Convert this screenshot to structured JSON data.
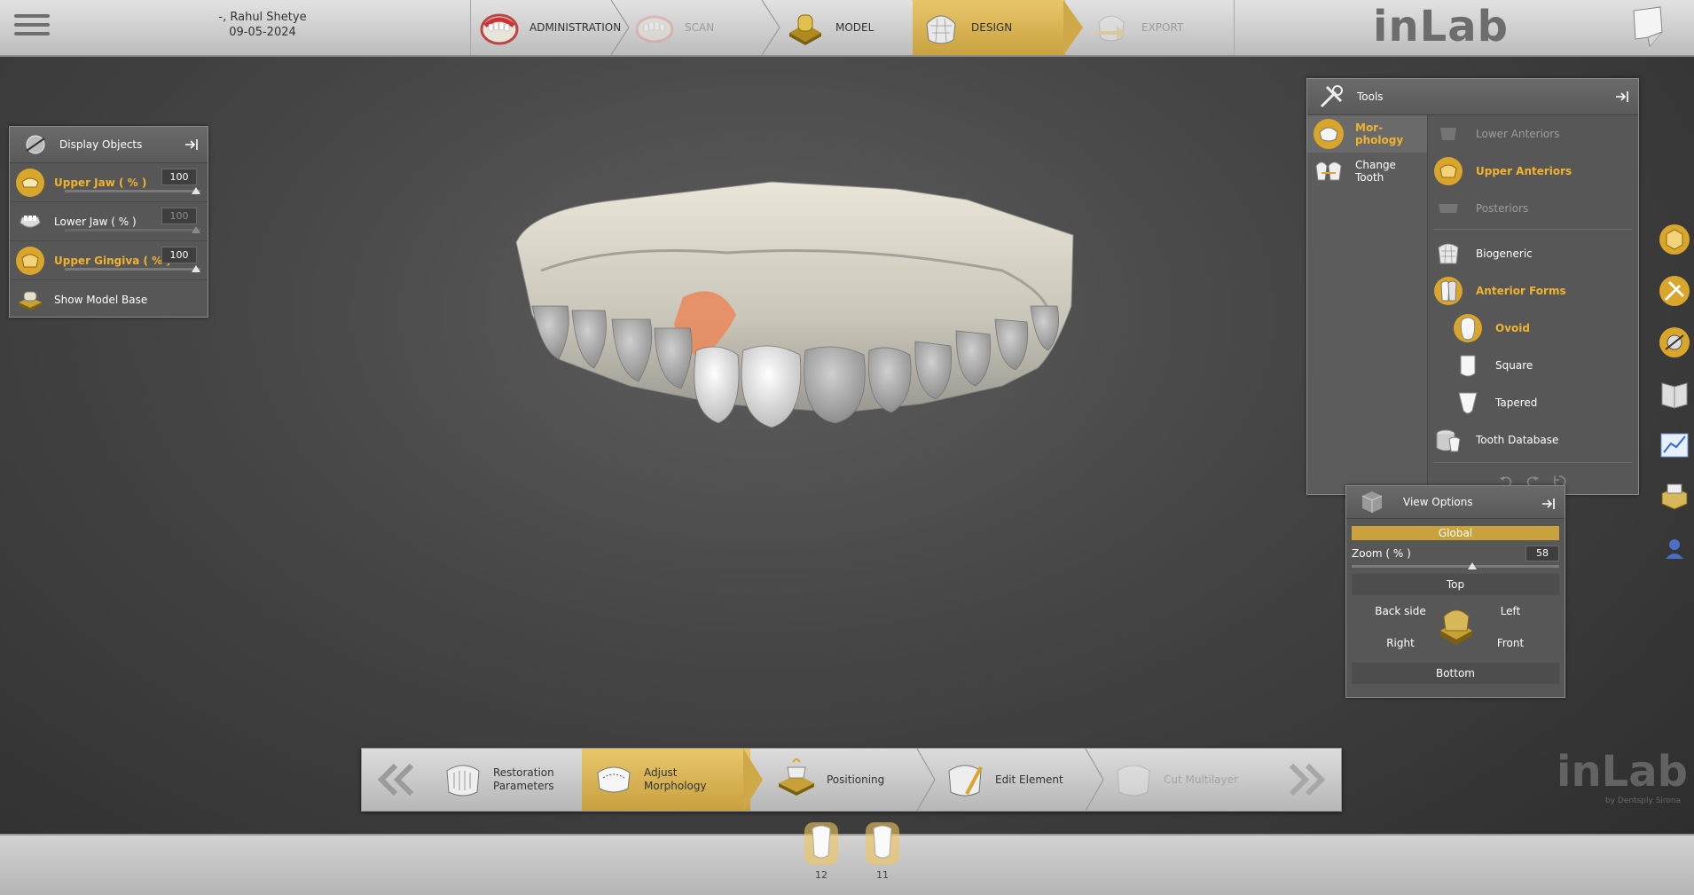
{
  "patient": {
    "name": "-, Rahul Shetye",
    "date": "09-05-2024"
  },
  "workflow": [
    {
      "label": "ADMINISTRATION",
      "state": "normal",
      "icon": "jaw-icon"
    },
    {
      "label": "SCAN",
      "state": "disabled",
      "icon": "scan-jaw-icon"
    },
    {
      "label": "MODEL",
      "state": "normal",
      "icon": "model-base-icon"
    },
    {
      "label": "DESIGN",
      "state": "active",
      "icon": "crown-design-icon"
    },
    {
      "label": "EXPORT",
      "state": "disabled",
      "icon": "export-icon"
    }
  ],
  "brand": {
    "logo": "inLab",
    "watermark": "inLab",
    "watermark_sub": "by Dentsply Sirona"
  },
  "display_objects": {
    "title": "Display Objects",
    "rows": [
      {
        "label": "Upper Jaw  ( % )",
        "value": "100",
        "style": "orange"
      },
      {
        "label": "Lower Jaw  ( % )",
        "value": "100",
        "style": "normal"
      },
      {
        "label": "Upper Gingiva  ( % )",
        "value": "100",
        "style": "orange"
      }
    ],
    "show_model_base": "Show Model Base"
  },
  "tools": {
    "title": "Tools",
    "left": [
      {
        "label": "Mor-\nphology",
        "selected": true
      },
      {
        "label": "Change\nTooth",
        "selected": false
      }
    ],
    "right": [
      {
        "label": "Lower Anteriors",
        "state": "disabled"
      },
      {
        "label": "Upper Anteriors",
        "state": "selected"
      },
      {
        "label": "Posteriors",
        "state": "disabled"
      },
      {
        "label": "Biogeneric",
        "state": "normal"
      },
      {
        "label": "Anterior Forms",
        "state": "selected"
      },
      {
        "label": "Ovoid",
        "state": "selected"
      },
      {
        "label": "Square",
        "state": "normal"
      },
      {
        "label": "Tapered",
        "state": "normal"
      },
      {
        "label": "Tooth Database",
        "state": "normal"
      }
    ]
  },
  "view_options": {
    "title": "View Options",
    "global": "Global",
    "zoom_label": "Zoom ( % )",
    "zoom_value": "58",
    "zoom_fraction": 0.58,
    "top": "Top",
    "back_side": "Back side",
    "left": "Left",
    "right": "Right",
    "front": "Front",
    "bottom": "Bottom"
  },
  "bottom_steps": [
    {
      "label": "Restoration\nParameters",
      "state": "normal"
    },
    {
      "label": "Adjust\nMorphology",
      "state": "active"
    },
    {
      "label": "Positioning",
      "state": "normal"
    },
    {
      "label": "Edit Element",
      "state": "normal"
    },
    {
      "label": "Cut Multilayer",
      "state": "disabled"
    }
  ],
  "teeth": [
    {
      "number": "12"
    },
    {
      "number": "11"
    }
  ],
  "colors": {
    "accent": "#f0b32e",
    "active_bg": "#d4ad4a",
    "panel": "#575757"
  }
}
